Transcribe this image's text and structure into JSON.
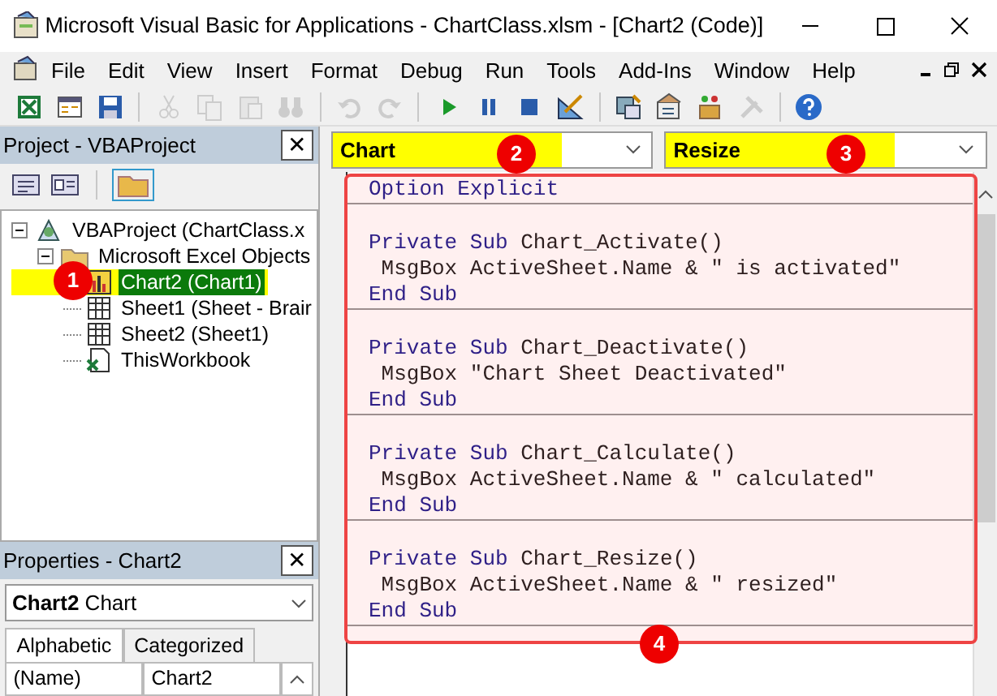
{
  "window": {
    "title": "Microsoft Visual Basic for Applications - ChartClass.xlsm - [Chart2 (Code)]"
  },
  "menu": [
    "File",
    "Edit",
    "View",
    "Insert",
    "Format",
    "Debug",
    "Run",
    "Tools",
    "Add-Ins",
    "Window",
    "Help"
  ],
  "toolbar": [
    {
      "kind": "excel",
      "disabled": false
    },
    {
      "kind": "form",
      "disabled": false
    },
    {
      "kind": "save",
      "disabled": false
    },
    {
      "kind": "sep"
    },
    {
      "kind": "cut",
      "disabled": true
    },
    {
      "kind": "copy",
      "disabled": true
    },
    {
      "kind": "paste",
      "disabled": true
    },
    {
      "kind": "find",
      "disabled": true
    },
    {
      "kind": "sep"
    },
    {
      "kind": "undo",
      "disabled": true
    },
    {
      "kind": "redo",
      "disabled": true
    },
    {
      "kind": "sep"
    },
    {
      "kind": "run",
      "disabled": false
    },
    {
      "kind": "pause",
      "disabled": false
    },
    {
      "kind": "stop",
      "disabled": false
    },
    {
      "kind": "design",
      "disabled": false
    },
    {
      "kind": "sep"
    },
    {
      "kind": "explorer",
      "disabled": false
    },
    {
      "kind": "properties",
      "disabled": false
    },
    {
      "kind": "objects",
      "disabled": false
    },
    {
      "kind": "tools",
      "disabled": true
    },
    {
      "kind": "sep"
    },
    {
      "kind": "help",
      "disabled": false
    }
  ],
  "project_pane": {
    "title": "Project - VBAProject",
    "close": "✕",
    "tree": [
      {
        "label": "VBAProject (ChartClass.x",
        "kind": "project",
        "expanded": true,
        "selected": false,
        "children": [
          {
            "label": "Microsoft Excel Objects",
            "kind": "folder",
            "expanded": true,
            "selected": false,
            "children": [
              {
                "label": "Chart2 (Chart1)",
                "kind": "chart",
                "selected": true,
                "highlighted": true
              },
              {
                "label": "Sheet1 (Sheet - Brair",
                "kind": "sheet",
                "selected": false,
                "highlighted": false
              },
              {
                "label": "Sheet2 (Sheet1)",
                "kind": "sheet",
                "selected": false,
                "highlighted": false
              },
              {
                "label": "ThisWorkbook",
                "kind": "workbook",
                "selected": false,
                "highlighted": false
              }
            ]
          }
        ]
      }
    ]
  },
  "properties_pane": {
    "title": "Properties - Chart2",
    "close": "✕",
    "object_name": "Chart2",
    "object_type": "Chart",
    "tabs": [
      {
        "label": "Alphabetic",
        "selected": true
      },
      {
        "label": "Categorized",
        "selected": false
      }
    ],
    "rows": [
      {
        "name": "(Name)",
        "value": "Chart2"
      }
    ]
  },
  "code_window": {
    "object_dropdown": {
      "value": "Chart",
      "highlighted": true
    },
    "procedure_dropdown": {
      "value": "Resize",
      "highlighted": true
    },
    "sections": [
      {
        "lines": [
          [
            {
              "text": "Option Explicit",
              "keyword": true
            }
          ]
        ]
      },
      {
        "lines": [
          [
            {
              "text": "Private Sub",
              "keyword": true
            },
            {
              "text": " Chart_Activate()",
              "keyword": false
            }
          ],
          [
            {
              "text": " MsgBox ActiveSheet.Name & \" is activated\"",
              "keyword": false
            }
          ],
          [
            {
              "text": "End Sub",
              "keyword": true
            }
          ]
        ]
      },
      {
        "lines": [
          [
            {
              "text": "Private Sub",
              "keyword": true
            },
            {
              "text": " Chart_Deactivate()",
              "keyword": false
            }
          ],
          [
            {
              "text": " MsgBox \"Chart Sheet Deactivated\"",
              "keyword": false
            }
          ],
          [
            {
              "text": "End Sub",
              "keyword": true
            }
          ]
        ]
      },
      {
        "lines": [
          [
            {
              "text": "Private Sub",
              "keyword": true
            },
            {
              "text": " Chart_Calculate()",
              "keyword": false
            }
          ],
          [
            {
              "text": " MsgBox ActiveSheet.Name & \" calculated\"",
              "keyword": false
            }
          ],
          [
            {
              "text": "End Sub",
              "keyword": true
            }
          ]
        ]
      },
      {
        "lines": [
          [
            {
              "text": "Private Sub",
              "keyword": true
            },
            {
              "text": " Chart_Resize()",
              "keyword": false
            }
          ],
          [
            {
              "text": " MsgBox ActiveSheet.Name & \" resized\"",
              "keyword": false
            }
          ],
          [
            {
              "text": "End Sub",
              "keyword": true
            }
          ]
        ]
      }
    ]
  },
  "annotations": [
    {
      "label": "1"
    },
    {
      "label": "2"
    },
    {
      "label": "3"
    },
    {
      "label": "4"
    }
  ]
}
